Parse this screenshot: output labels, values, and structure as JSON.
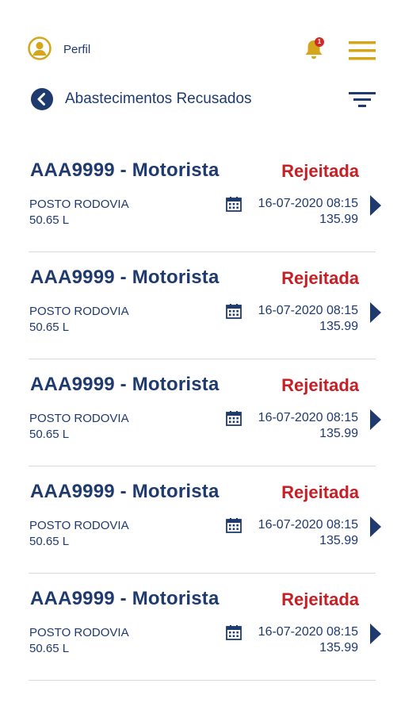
{
  "header": {
    "profile_label": "Perfil",
    "notification_count": "1"
  },
  "subheader": {
    "title": "Abastecimentos Recusados"
  },
  "colors": {
    "primary": "#1f3a6e",
    "accent_gold": "#d4a61b",
    "rejected_red": "#c62026"
  },
  "items": [
    {
      "title": "AAA9999 - Motorista",
      "status": "Rejeitada",
      "station": "POSTO RODOVIA",
      "liters": "50.65 L",
      "datetime": "16-07-2020 08:15",
      "value": "135.99"
    },
    {
      "title": "AAA9999 - Motorista",
      "status": "Rejeitada",
      "station": "POSTO RODOVIA",
      "liters": "50.65 L",
      "datetime": "16-07-2020 08:15",
      "value": "135.99"
    },
    {
      "title": "AAA9999 - Motorista",
      "status": "Rejeitada",
      "station": "POSTO RODOVIA",
      "liters": "50.65 L",
      "datetime": "16-07-2020 08:15",
      "value": "135.99"
    },
    {
      "title": "AAA9999 - Motorista",
      "status": "Rejeitada",
      "station": "POSTO RODOVIA",
      "liters": "50.65 L",
      "datetime": "16-07-2020 08:15",
      "value": "135.99"
    },
    {
      "title": "AAA9999 - Motorista",
      "status": "Rejeitada",
      "station": "POSTO RODOVIA",
      "liters": "50.65 L",
      "datetime": "16-07-2020 08:15",
      "value": "135.99"
    }
  ]
}
